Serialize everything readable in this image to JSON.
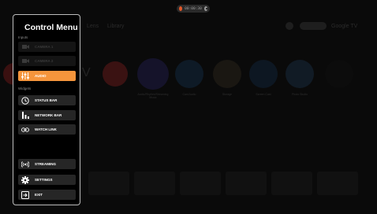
{
  "background": {
    "tabs": [
      "Lens",
      "Library"
    ],
    "top_right_label": "Google TV",
    "app_labels": [
      "Audio/Rhythm/Streaming Music",
      "Cast Audio",
      "Storage",
      "Screen Cast",
      "Photo Studio"
    ]
  },
  "recording": {
    "time": "00:00:30",
    "dot_color": "#e2582a"
  },
  "menu": {
    "title": "Control Menu",
    "inputs_header": "Inputs",
    "inputs": [
      {
        "label": "CAMERA 1",
        "icon": "camera-icon",
        "state": "disabled"
      },
      {
        "label": "CAMERA 2",
        "icon": "camera-icon",
        "state": "disabled"
      },
      {
        "label": "AUDIO",
        "icon": "audio-sliders-icon",
        "state": "active"
      }
    ],
    "widgets_header": "Widgets",
    "widgets": [
      {
        "label": "STATUS BAR",
        "icon": "clock-icon"
      },
      {
        "label": "NETWORK BAR",
        "icon": "bar-chart-icon"
      },
      {
        "label": "WATCH LINK",
        "icon": "link-icon"
      }
    ],
    "actions": [
      {
        "label": "STREAMING",
        "icon": "broadcast-icon"
      },
      {
        "label": "SETTINGS",
        "icon": "gear-icon"
      },
      {
        "label": "EXIT",
        "icon": "exit-icon"
      }
    ],
    "accent_color": "#f5953c"
  }
}
